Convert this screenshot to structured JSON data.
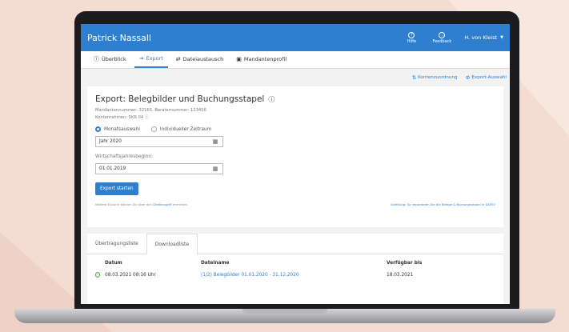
{
  "header": {
    "brand": "Patrick Nassall",
    "help": {
      "icon": "question-icon",
      "label": "Hilfe"
    },
    "feedback": {
      "icon": "speech-bubble-icon",
      "label": "Feedback"
    },
    "user": "H. von Kleist"
  },
  "tabs": [
    {
      "label": "Überblick",
      "icon": "info-circle-icon"
    },
    {
      "label": "Export",
      "icon": "export-arrow-icon",
      "active": true
    },
    {
      "label": "Dateiaustausch",
      "icon": "exchange-arrows-icon"
    },
    {
      "label": "Mandantenprofil",
      "icon": "profile-card-icon"
    }
  ],
  "actions": {
    "kontenzuordnung": "Kontenzuordnung",
    "export_auswahl": "Export-Auswahl"
  },
  "export_card": {
    "title": "Export: Belegbilder und Buchungsstapel",
    "mandant_line": "Mandantennummer: 32165, Beraternummer: 123456",
    "kontenrahmen": "Kontenrahmen: SKR 04",
    "radio_month": "Monatsauswahl",
    "radio_custom": "Individueller Zeitraum",
    "year_value": "Jahr 2020",
    "wj_label": "Wirtschaftsjahresbeginn:",
    "wj_value": "01.01.2019",
    "button": "Export starten",
    "footer_left_prefix": "Weitere Exporte können Sie über den",
    "footer_left_link": "Direktzugriff",
    "footer_left_suffix": "erreichen.",
    "footer_right": "Anleitung: So importieren Sie die Belege & Buchungsstapel in DATEV"
  },
  "download_panel": {
    "tabs": [
      "Übertragungsliste",
      "Downloadliste"
    ],
    "columns": [
      "Datum",
      "Dateiname",
      "Verfügbar bis"
    ],
    "rows": [
      {
        "datum": "08.03.2021 08:16 Uhr",
        "dateiname": "(1/2) Belegbilder 01.01.2020 - 31.12.2020",
        "verfuegbar": "18.03.2021"
      }
    ]
  },
  "colors": {
    "accent": "#2f7fd1",
    "background": "#f3ddd3",
    "success": "#4caf50"
  }
}
